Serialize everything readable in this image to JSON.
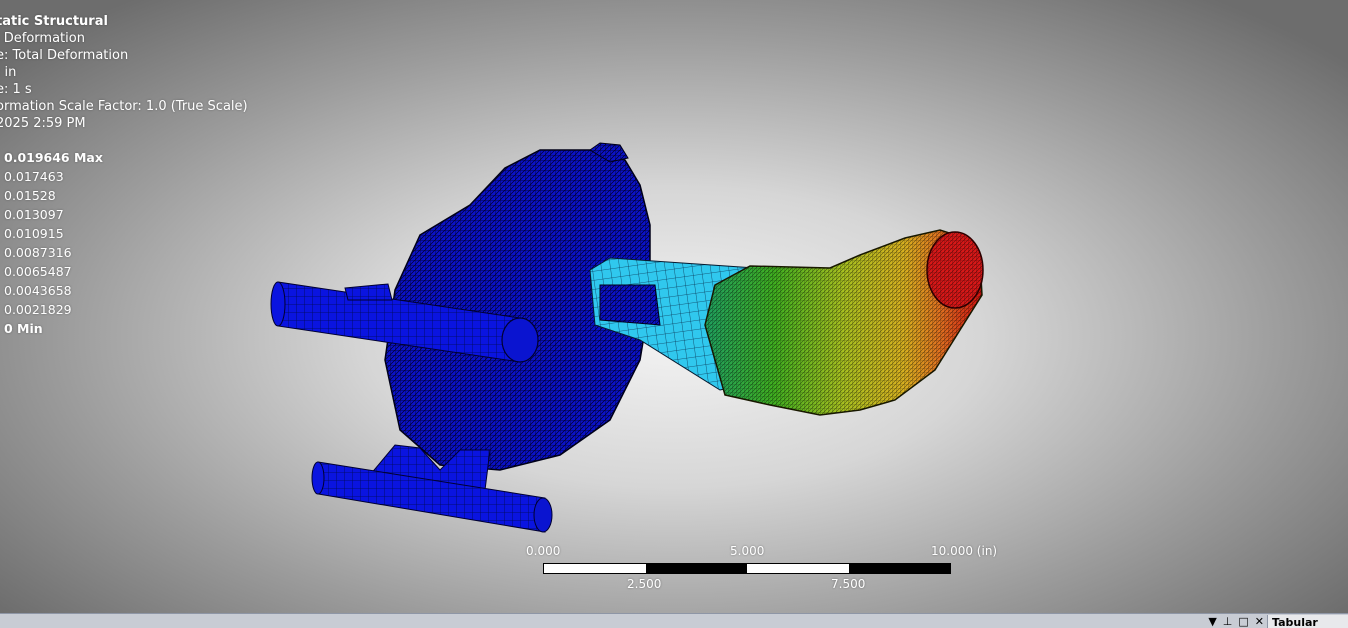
{
  "info": {
    "analysis": "tatic Structural",
    "result": "l Deformation",
    "type": "e: Total Deformation",
    "unit": ": in",
    "time": "e: 1 s",
    "scale_factor": "ormation Scale Factor: 1.0 (True Scale)",
    "date": "2025 2:59 PM"
  },
  "legend": [
    {
      "label": "0.019646 Max",
      "color": "#e0161a"
    },
    {
      "label": "0.017463",
      "color": "#e89a20"
    },
    {
      "label": "0.01528",
      "color": "#d8d020"
    },
    {
      "label": "0.013097",
      "color": "#a0e030"
    },
    {
      "label": "0.010915",
      "color": "#30c030"
    },
    {
      "label": "0.0087316",
      "color": "#20d0b0"
    },
    {
      "label": "0.0065487",
      "color": "#30c8f0"
    },
    {
      "label": "0.0043658",
      "color": "#2070f0"
    },
    {
      "label": "0.0021829",
      "color": "#1030e0"
    },
    {
      "label": "0 Min",
      "color": "#0000ff"
    }
  ],
  "scale_bar": {
    "top_labels": [
      "0.000",
      "5.000",
      "10.000 (in)"
    ],
    "bottom_labels": [
      "2.500",
      "7.500"
    ]
  },
  "statusbar": {
    "tabular_tab": "Tabular Data",
    "controls": [
      "▼",
      "⊥",
      "□",
      "✕"
    ]
  }
}
